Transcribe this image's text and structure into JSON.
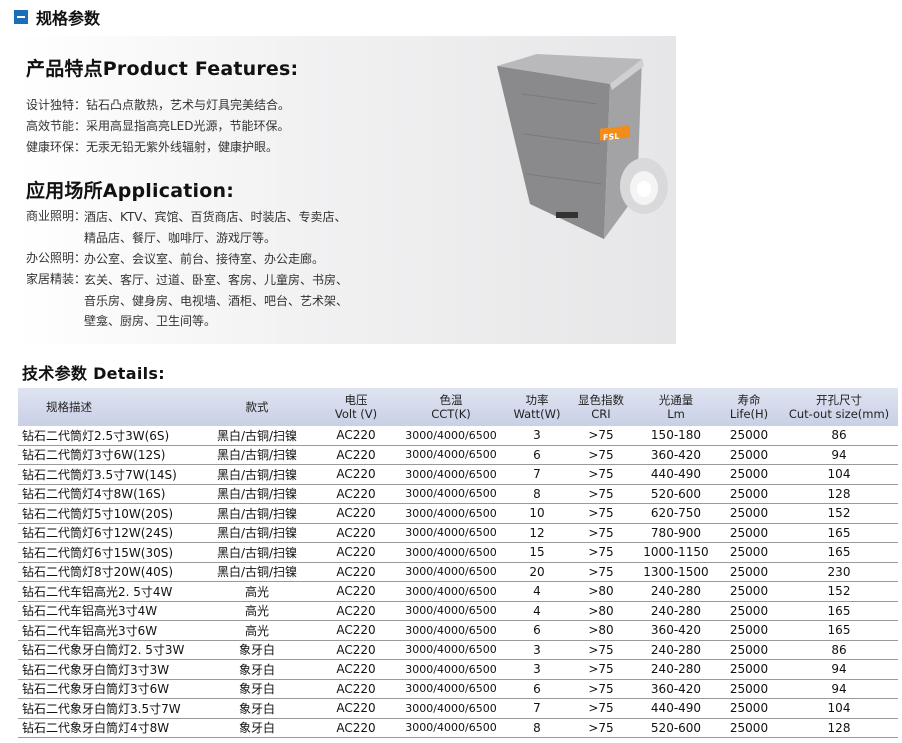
{
  "section": {
    "title": "规格参数"
  },
  "features": {
    "heading": "产品特点Product Features:",
    "items": [
      "设计独特：钻石凸点散热，艺术与灯具完美结合。",
      "高效节能：采用高显指高亮LED光源，节能环保。",
      "健康环保：无汞无铅无紫外线辐射，健康护眼。"
    ]
  },
  "application": {
    "heading": "应用场所Application:",
    "rows": [
      {
        "label": "商业照明：",
        "lines": [
          "酒店、KTV、宾馆、百货商店、时装店、专卖店、",
          "精品店、餐厅、咖啡厅、游戏厅等。"
        ]
      },
      {
        "label": "办公照明：",
        "lines": [
          "办公室、会议室、前台、接待室、办公走廊。"
        ]
      },
      {
        "label": "家居精装：",
        "lines": [
          "玄关、客厅、过道、卧室、客房、儿童房、书房、",
          "音乐房、健身房、电视墙、酒柜、吧台、艺术架、",
          "壁龛、厨房、卫生间等。"
        ]
      }
    ]
  },
  "product_image": {
    "brand_text": "FSL"
  },
  "details": {
    "title": "技术参数 Details:",
    "headers": [
      {
        "l1": "规格描述",
        "l2": ""
      },
      {
        "l1": "款式",
        "l2": ""
      },
      {
        "l1": "电压",
        "l2": "Volt (V)"
      },
      {
        "l1": "色温",
        "l2": "CCT(K)"
      },
      {
        "l1": "功率",
        "l2": "Watt(W)"
      },
      {
        "l1": "显色指数",
        "l2": "CRI"
      },
      {
        "l1": "光通量",
        "l2": "Lm"
      },
      {
        "l1": "寿命",
        "l2": "Life(H)"
      },
      {
        "l1": "开孔尺寸",
        "l2": "Cut-out size(mm)"
      }
    ],
    "rows": [
      [
        "钻石二代筒灯2.5寸3W(6S)",
        "黑白/古铜/扫镍",
        "AC220",
        "3000/4000/6500",
        "3",
        ">75",
        "150-180",
        "25000",
        "86"
      ],
      [
        "钻石二代筒灯3寸6W(12S)",
        "黑白/古铜/扫镍",
        "AC220",
        "3000/4000/6500",
        "6",
        ">75",
        "360-420",
        "25000",
        "94"
      ],
      [
        "钻石二代筒灯3.5寸7W(14S)",
        "黑白/古铜/扫镍",
        "AC220",
        "3000/4000/6500",
        "7",
        ">75",
        "440-490",
        "25000",
        "104"
      ],
      [
        "钻石二代筒灯4寸8W(16S)",
        "黑白/古铜/扫镍",
        "AC220",
        "3000/4000/6500",
        "8",
        ">75",
        "520-600",
        "25000",
        "128"
      ],
      [
        "钻石二代筒灯5寸10W(20S)",
        "黑白/古铜/扫镍",
        "AC220",
        "3000/4000/6500",
        "10",
        ">75",
        "620-750",
        "25000",
        "152"
      ],
      [
        "钻石二代筒灯6寸12W(24S)",
        "黑白/古铜/扫镍",
        "AC220",
        "3000/4000/6500",
        "12",
        ">75",
        "780-900",
        "25000",
        "165"
      ],
      [
        "钻石二代筒灯6寸15W(30S)",
        "黑白/古铜/扫镍",
        "AC220",
        "3000/4000/6500",
        "15",
        ">75",
        "1000-1150",
        "25000",
        "165"
      ],
      [
        "钻石二代筒灯8寸20W(40S)",
        "黑白/古铜/扫镍",
        "AC220",
        "3000/4000/6500",
        "20",
        ">75",
        "1300-1500",
        "25000",
        "230"
      ],
      [
        "钻石二代车铝高光2. 5寸4W",
        "高光",
        "AC220",
        "3000/4000/6500",
        "4",
        ">80",
        "240-280",
        "25000",
        "152"
      ],
      [
        "钻石二代车铝高光3寸4W",
        "高光",
        "AC220",
        "3000/4000/6500",
        "4",
        ">80",
        "240-280",
        "25000",
        "165"
      ],
      [
        "钻石二代车铝高光3寸6W",
        "高光",
        "AC220",
        "3000/4000/6500",
        "6",
        ">80",
        "360-420",
        "25000",
        "165"
      ],
      [
        "钻石二代象牙白筒灯2. 5寸3W",
        "象牙白",
        "AC220",
        "3000/4000/6500",
        "3",
        ">75",
        "240-280",
        "25000",
        "86"
      ],
      [
        "钻石二代象牙白筒灯3寸3W",
        "象牙白",
        "AC220",
        "3000/4000/6500",
        "3",
        ">75",
        "240-280",
        "25000",
        "94"
      ],
      [
        "钻石二代象牙白筒灯3寸6W",
        "象牙白",
        "AC220",
        "3000/4000/6500",
        "6",
        ">75",
        "360-420",
        "25000",
        "94"
      ],
      [
        "钻石二代象牙白筒灯3.5寸7W",
        "象牙白",
        "AC220",
        "3000/4000/6500",
        "7",
        ">75",
        "440-490",
        "25000",
        "104"
      ],
      [
        "钻石二代象牙白筒灯4寸8W",
        "象牙白",
        "AC220",
        "3000/4000/6500",
        "8",
        ">75",
        "520-600",
        "25000",
        "128"
      ]
    ]
  },
  "colors": {
    "accent": "#1b6fb8",
    "header_bg": "#d3d9ec",
    "panel_bg": "#ececee"
  }
}
